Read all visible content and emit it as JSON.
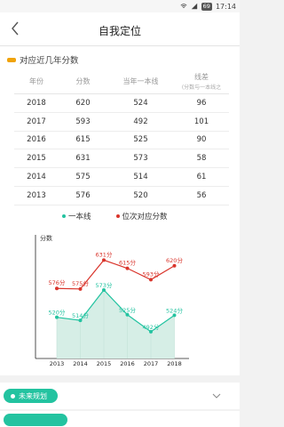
{
  "status_bar": {
    "battery": "69",
    "time": "17:14"
  },
  "header": {
    "title": "自我定位"
  },
  "section": {
    "title": "对应近几年分数"
  },
  "table": {
    "headers": [
      "年份",
      "分数",
      "当年一本线",
      "线差"
    ],
    "header_note": "(分数与一本线之",
    "rows": [
      [
        "2018",
        "620",
        "524",
        "96"
      ],
      [
        "2017",
        "593",
        "492",
        "101"
      ],
      [
        "2016",
        "615",
        "525",
        "90"
      ],
      [
        "2015",
        "631",
        "573",
        "58"
      ],
      [
        "2014",
        "575",
        "514",
        "61"
      ],
      [
        "2013",
        "576",
        "520",
        "56"
      ]
    ]
  },
  "chart_data": {
    "type": "line",
    "ylabel": "分数",
    "categories": [
      "2013",
      "2014",
      "2015",
      "2016",
      "2017",
      "2018"
    ],
    "series": [
      {
        "name": "一本线",
        "values": [
          520,
          514,
          573,
          525,
          492,
          524
        ],
        "color": "#23c3a0",
        "area": true
      },
      {
        "name": "位次对应分数",
        "values": [
          576,
          575,
          631,
          615,
          593,
          620
        ],
        "color": "#d9342b"
      }
    ],
    "value_labels": {
      "一本线": [
        "520分",
        "514分",
        "573分",
        "525分",
        "492分",
        "524分"
      ],
      "位次对应分数": [
        "576分",
        "575分",
        "631分",
        "615分",
        "593分",
        "620分"
      ]
    }
  },
  "plan": {
    "label": "未来规划"
  },
  "colors": {
    "accent": "#23c3a0",
    "red": "#d9342b",
    "orange": "#f0a30a"
  }
}
